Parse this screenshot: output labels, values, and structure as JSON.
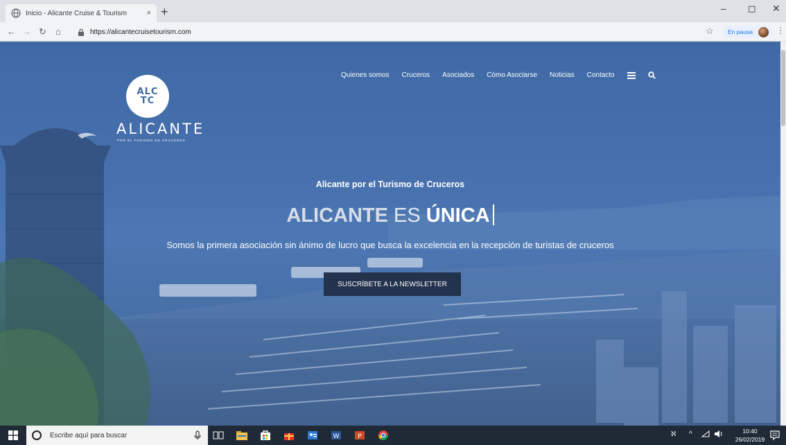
{
  "browser": {
    "tab_title": "Inicio - Alicante Cruise & Tourism",
    "tab_close": "×",
    "new_tab": "+",
    "url": "https://alicantecruisetourism.com",
    "profile_status": "En pausa",
    "window_controls": {
      "minimize": "–",
      "maximize": "◻",
      "close": "✕"
    }
  },
  "site": {
    "logo": {
      "badge_top": "ALC",
      "badge_bottom": "TC",
      "wordmark": "ALICANTE",
      "tagline": "POR EL TURISMO DE CRUCEROS"
    },
    "nav": {
      "items": [
        "Quienes somos",
        "Cruceros",
        "Asociados",
        "Cómo Asociarse",
        "Noticias",
        "Contacto"
      ],
      "menu_icon": "hamburger-icon",
      "search_icon": "search-icon"
    },
    "hero": {
      "subtitle": "Alicante por el Turismo de Cruceros",
      "title_part1": "ALICANTE",
      "title_part2": "ES",
      "title_part3": "ÚNICA",
      "description": "Somos la primera asociación sin ánimo de lucro que busca la excelencia en la recepción de turistas de cruceros",
      "cta": "SUSCRÍBETE A LA NEWSLETTER"
    }
  },
  "taskbar": {
    "search_placeholder": "Escribe aquí para buscar",
    "time": "10:40",
    "date": "26/02/2019"
  },
  "colors": {
    "overlay_blue": "#4770ad",
    "button_bg": "#23324d",
    "taskbar_bg": "#1f2a36"
  }
}
